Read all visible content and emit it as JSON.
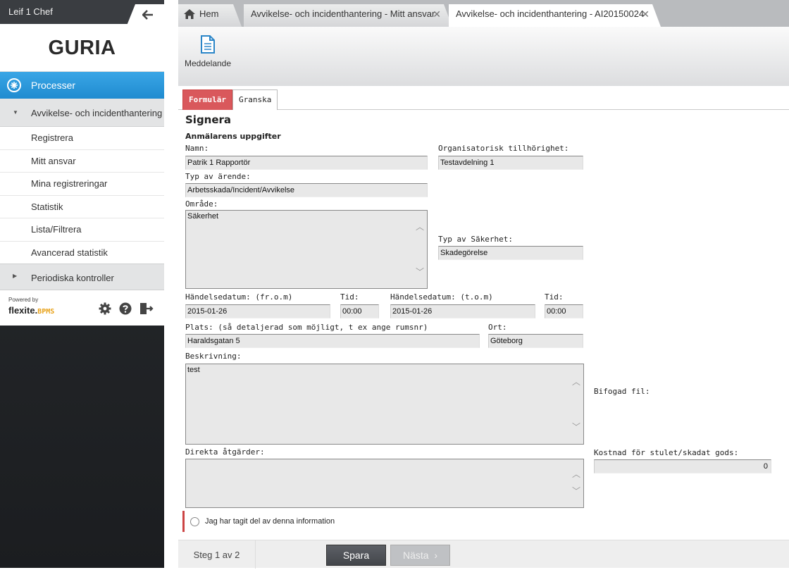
{
  "sidebar": {
    "user_name": "Leif 1 Chef",
    "logo": "GURIA",
    "section_label": "Processer",
    "group_label": "Avvikelse- och incidenthantering",
    "items": [
      {
        "label": "Registrera"
      },
      {
        "label": "Mitt ansvar"
      },
      {
        "label": "Mina registreringar"
      },
      {
        "label": "Statistik"
      },
      {
        "label": "Lista/Filtrera"
      },
      {
        "label": "Avancerad statistik"
      }
    ],
    "periodic_label": "Periodiska kontroller",
    "powered_by": "Powered by",
    "brand_name": "flexite.",
    "brand_suffix": "BPMS"
  },
  "tabs": [
    {
      "label": "Hem",
      "icon": "home-icon"
    },
    {
      "label": "Avvikelse- och incidenthantering - Mitt ansvar"
    },
    {
      "label": "Avvikelse- och incidenthantering - AI20150024"
    }
  ],
  "toolbar": {
    "message_label": "Meddelande"
  },
  "form_tabs": {
    "active": "Formulär",
    "other": "Granska"
  },
  "form": {
    "heading": "Signera",
    "section_title": "Anmälarens uppgifter",
    "name_label": "Namn:",
    "name_value": "Patrik 1 Rapportör",
    "org_label": "Organisatorisk tillhörighet:",
    "org_value": "Testavdelning 1",
    "type_label": "Typ av ärende:",
    "type_value": "Arbetsskada/Incident/Avvikelse",
    "area_label": "Område:",
    "area_value": "Säkerhet",
    "safety_type_label": "Typ av Säkerhet:",
    "safety_type_value": "Skadegörelse",
    "date_from_label": "Händelsedatum:  (fr.o.m)",
    "date_from_value": "2015-01-26",
    "time1_label": "Tid:",
    "time1_value": "00:00",
    "date_to_label": "Händelsedatum: (t.o.m)",
    "date_to_value": "2015-01-26",
    "time2_label": "Tid:",
    "time2_value": "00:00",
    "place_label": "Plats: (så detaljerad som möjligt, t ex ange rumsnr)",
    "place_value": "Haraldsgatan 5",
    "city_label": "Ort:",
    "city_value": "Göteborg",
    "desc_label": "Beskrivning:",
    "desc_value": "test",
    "attachment_label": "Bifogad fil:",
    "actions_label": "Direkta åtgärder:",
    "actions_value": "",
    "cost_label": "Kostnad för stulet/skadat gods:",
    "cost_value": "0",
    "consent_label": "Jag har tagit del av denna information"
  },
  "footer": {
    "step": "Steg 1 av 2",
    "save": "Spara",
    "next": "Nästa"
  }
}
